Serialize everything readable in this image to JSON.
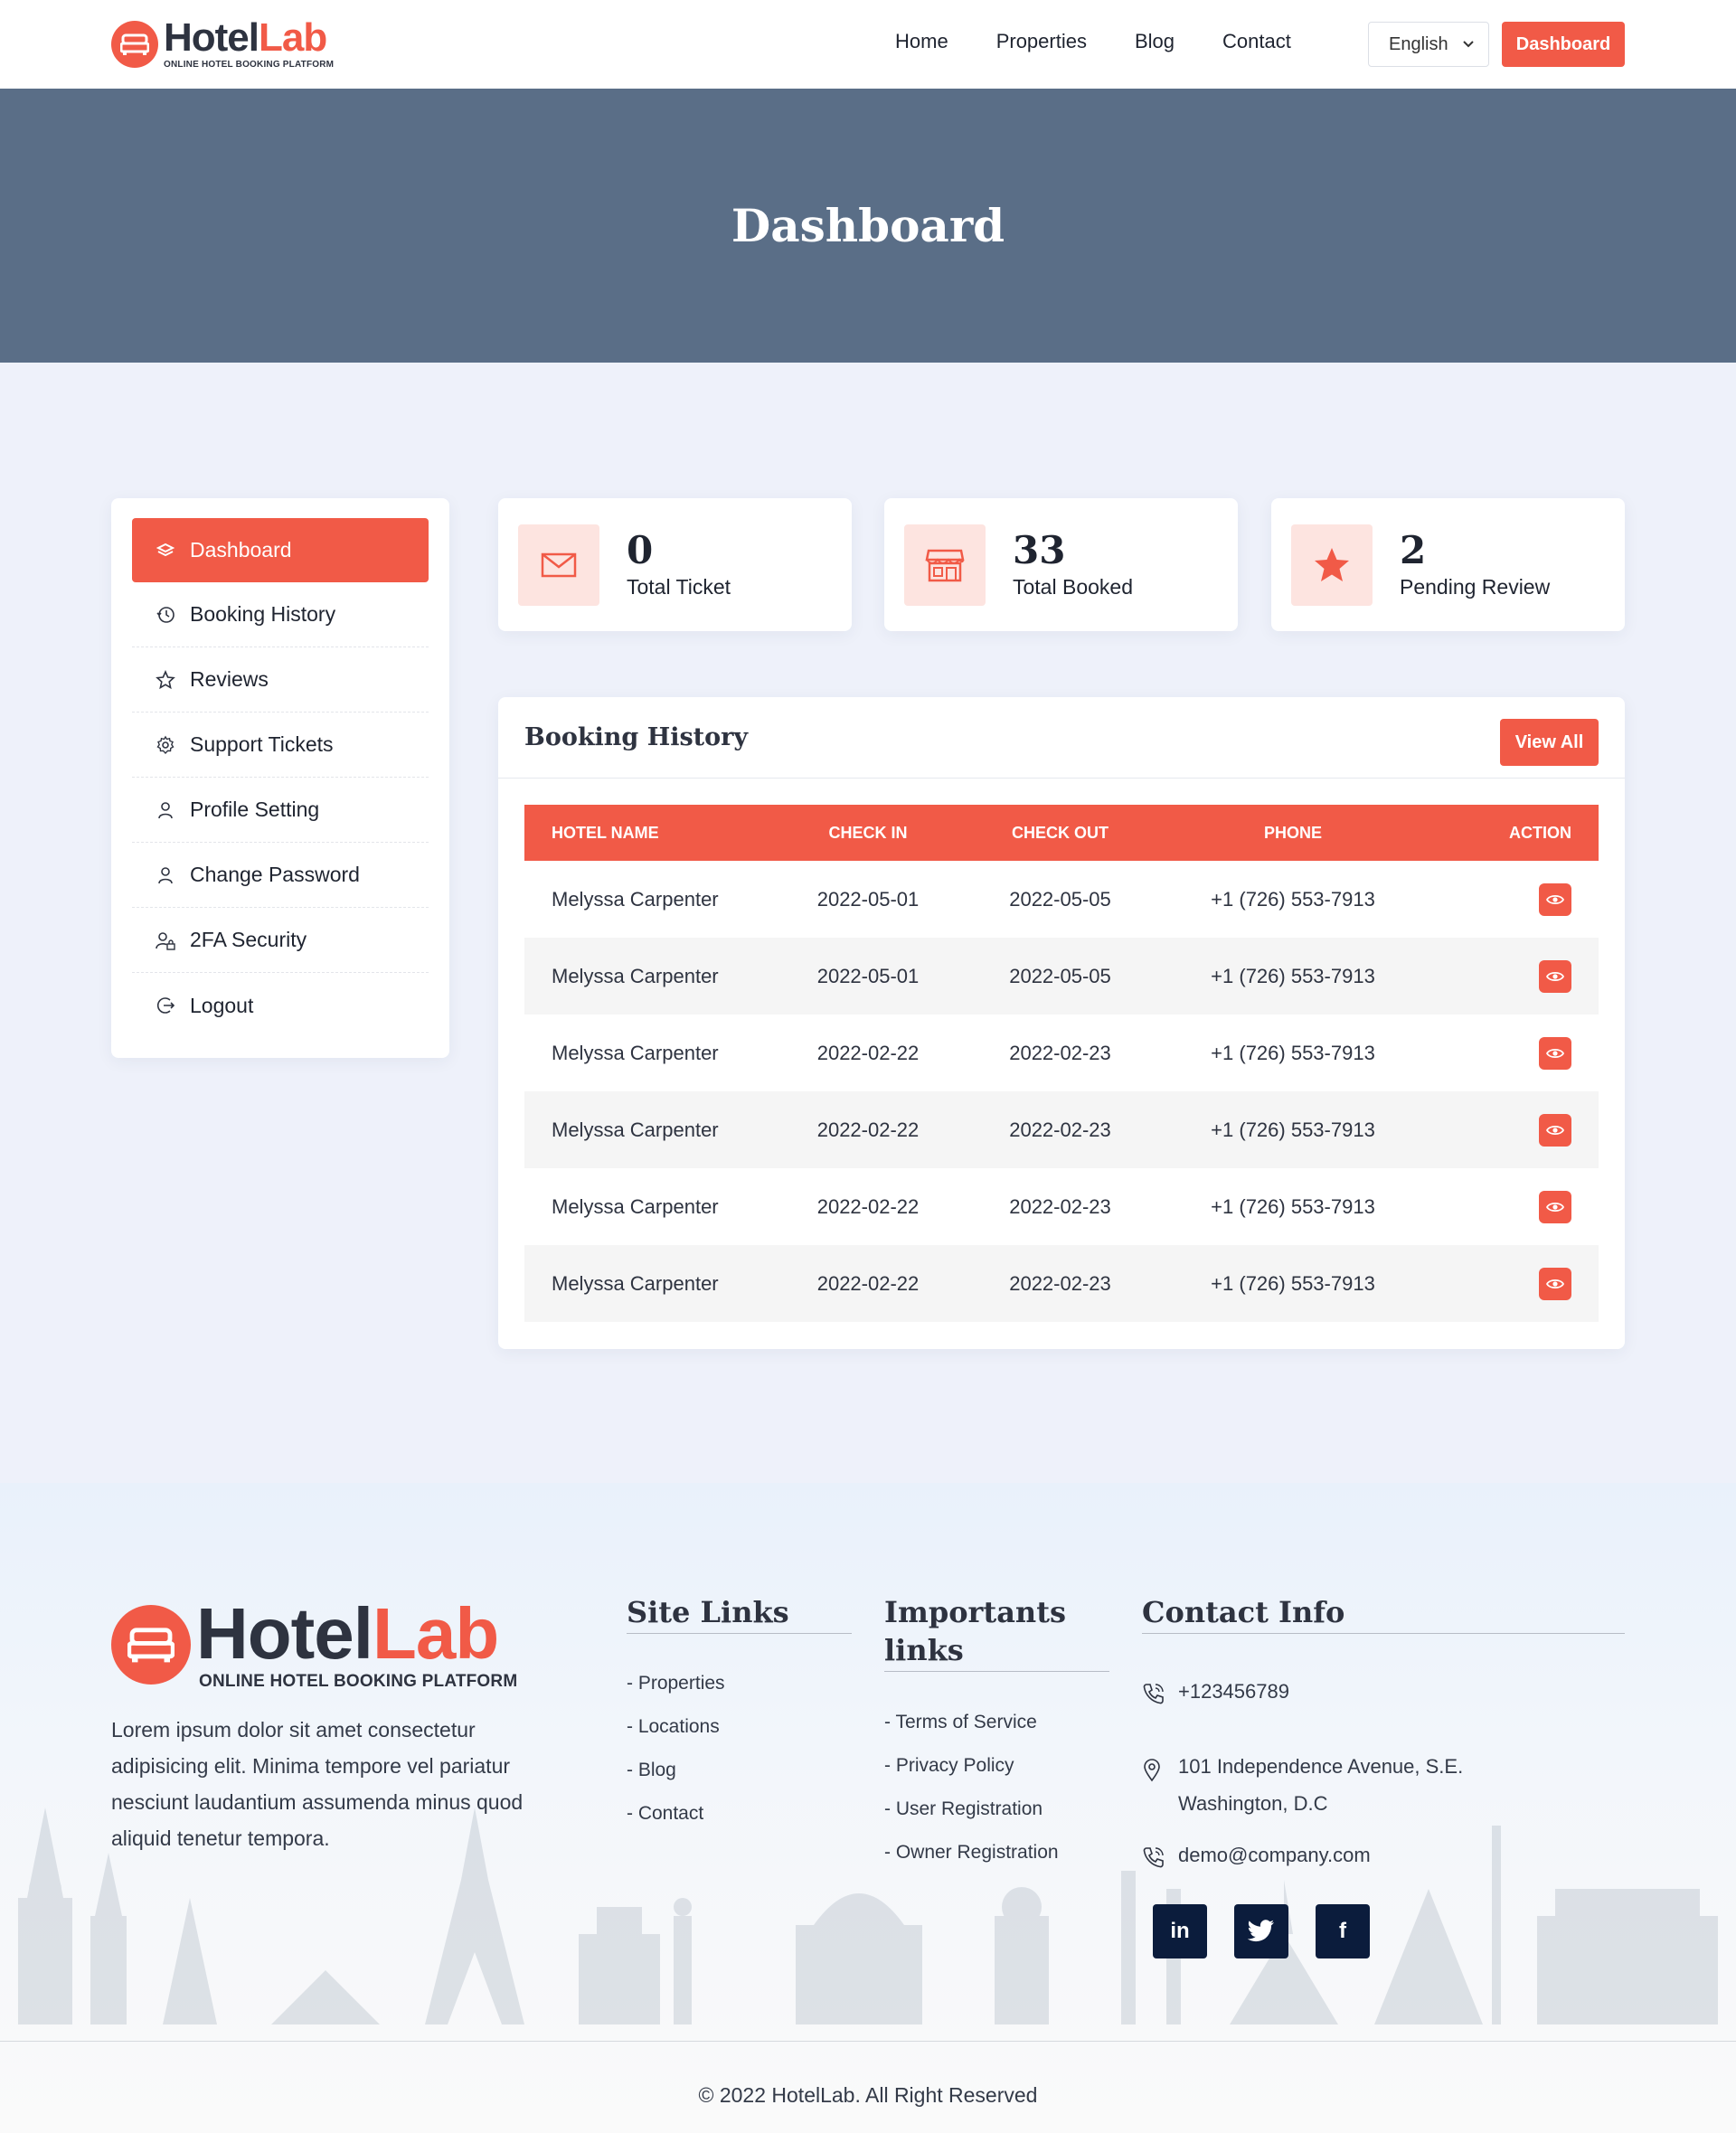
{
  "brand": {
    "name_part1": "Hotel",
    "name_part2": "Lab",
    "tagline": "ONLINE HOTEL BOOKING PLATFORM",
    "accent": "#f15a47",
    "dark": "#0b1c3c"
  },
  "nav": {
    "items": [
      "Home",
      "Properties",
      "Blog",
      "Contact"
    ],
    "language": "English",
    "dashboard_button": "Dashboard"
  },
  "banner": {
    "title": "Dashboard"
  },
  "sidebar": {
    "items": [
      {
        "label": "Dashboard",
        "icon": "layers-icon"
      },
      {
        "label": "Booking History",
        "icon": "history-icon"
      },
      {
        "label": "Reviews",
        "icon": "star-icon"
      },
      {
        "label": "Support Tickets",
        "icon": "gear-icon"
      },
      {
        "label": "Profile Setting",
        "icon": "user-icon"
      },
      {
        "label": "Change Password",
        "icon": "user-icon"
      },
      {
        "label": "2FA Security",
        "icon": "user-lock-icon"
      },
      {
        "label": "Logout",
        "icon": "logout-icon"
      }
    ]
  },
  "stats": [
    {
      "value": "0",
      "label": "Total Ticket",
      "icon": "envelope-icon"
    },
    {
      "value": "33",
      "label": "Total Booked",
      "icon": "store-icon"
    },
    {
      "value": "2",
      "label": "Pending Review",
      "icon": "star-icon"
    }
  ],
  "booking": {
    "title": "Booking History",
    "view_all": "View All",
    "columns": [
      "HOTEL NAME",
      "CHECK IN",
      "CHECK OUT",
      "PHONE",
      "ACTION"
    ],
    "rows": [
      {
        "hotel": "Melyssa Carpenter",
        "check_in": "2022-05-01",
        "check_out": "2022-05-05",
        "phone": "+1 (726) 553-7913"
      },
      {
        "hotel": "Melyssa Carpenter",
        "check_in": "2022-05-01",
        "check_out": "2022-05-05",
        "phone": "+1 (726) 553-7913"
      },
      {
        "hotel": "Melyssa Carpenter",
        "check_in": "2022-02-22",
        "check_out": "2022-02-23",
        "phone": "+1 (726) 553-7913"
      },
      {
        "hotel": "Melyssa Carpenter",
        "check_in": "2022-02-22",
        "check_out": "2022-02-23",
        "phone": "+1 (726) 553-7913"
      },
      {
        "hotel": "Melyssa Carpenter",
        "check_in": "2022-02-22",
        "check_out": "2022-02-23",
        "phone": "+1 (726) 553-7913"
      },
      {
        "hotel": "Melyssa Carpenter",
        "check_in": "2022-02-22",
        "check_out": "2022-02-23",
        "phone": "+1 (726) 553-7913"
      }
    ]
  },
  "footer": {
    "about": "Lorem ipsum dolor sit amet consectetur adipisicing elit. Minima tempore vel pariatur nesciunt laudantium assumenda minus quod aliquid tenetur tempora.",
    "site_links": {
      "title": "Site Links",
      "items": [
        "- Properties",
        "- Locations",
        "- Blog",
        "- Contact"
      ]
    },
    "important_links": {
      "title_line1": "Importants",
      "title_line2": "links",
      "items": [
        "- Terms of Service",
        "- Privacy Policy",
        "- User Registration",
        "- Owner Registration"
      ]
    },
    "contact": {
      "title": "Contact Info",
      "phone": "+123456789",
      "address_line1": "101 Independence Avenue, S.E.",
      "address_line2": "Washington, D.C",
      "email": "demo@company.com"
    },
    "social": [
      {
        "label": "in",
        "icon": "linkedin-icon"
      },
      {
        "label": "twitter",
        "icon": "twitter-icon"
      },
      {
        "label": "f",
        "icon": "facebook-icon"
      }
    ],
    "copyright": "© 2022 HotelLab. All Right Reserved"
  }
}
